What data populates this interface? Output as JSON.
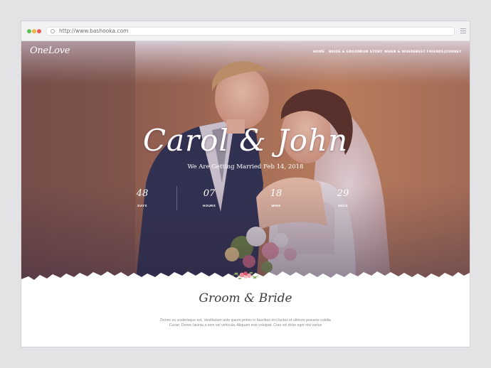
{
  "browser": {
    "url": "http://www.bashooka.com",
    "dot_colors": [
      "#5fc05a",
      "#f0b444",
      "#ec5f5f"
    ]
  },
  "site": {
    "logo": "OneLove",
    "nav": {
      "home": "HOME",
      "bride_groom": "BRIDE & GROOM",
      "our_story": "OUR STORY",
      "when_where": "WHEN & WHERE",
      "best_friends": "BEST FRIENDS",
      "journey": "JOURNEY"
    }
  },
  "hero": {
    "title": "Carol & John",
    "subtitle": "We Are Getting Married Feb 14, 2018",
    "countdown": {
      "days": {
        "value": "48",
        "label": "DAYS"
      },
      "hours": {
        "value": "07",
        "label": "HOURS"
      },
      "mins": {
        "value": "18",
        "label": "MINS"
      },
      "secs": {
        "value": "29",
        "label": "SECS"
      }
    }
  },
  "section": {
    "title": "Groom & Bride",
    "text_line_1": "Donec eu scelerisque est. Vestibulum ante ipsum primis in faucibus orci luctus et ultrices posuere cubilia",
    "text_line_2": "Curae; Donec lacinia a sem vel vehicula. Aliquam erat volutpat. Cras vel dolor eget nisi varius"
  },
  "colors": {
    "overlay_top": "#ece4ea",
    "wall": "#a86e54",
    "suit": "#2e3352",
    "white_text": "#ffffff"
  }
}
